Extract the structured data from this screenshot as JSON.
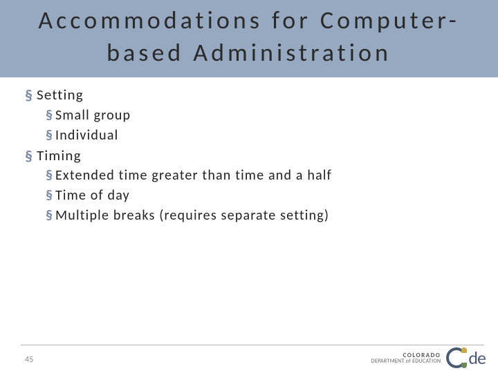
{
  "title_line1": "Accommodations for Computer-",
  "title_line2": "based Administration",
  "bullets": {
    "setting": "Setting",
    "setting_sub": {
      "a": "Small group",
      "b": "Individual"
    },
    "timing": "Timing",
    "timing_sub": {
      "a": "Extended time greater than time and a half",
      "b": "Time of day",
      "c": "Multiple breaks (requires separate setting)"
    }
  },
  "page_number": "45",
  "logo": {
    "colorado": "COLORADO",
    "dept": "DEPARTMENT of EDUCATION",
    "de": "de"
  }
}
